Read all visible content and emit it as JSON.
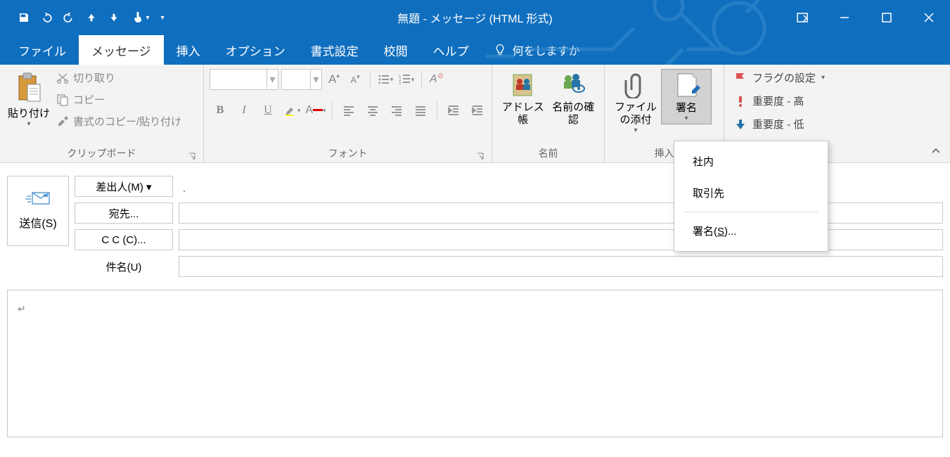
{
  "window": {
    "title": "無題  -  メッセージ (HTML 形式)"
  },
  "tabs": {
    "file": "ファイル",
    "message": "メッセージ",
    "insert": "挿入",
    "options": "オプション",
    "format": "書式設定",
    "review": "校閲",
    "help": "ヘルプ",
    "tell_me": "何をしますか"
  },
  "ribbon": {
    "clipboard": {
      "label": "クリップボード",
      "paste": "貼り付け",
      "cut": "切り取り",
      "copy": "コピー",
      "format_painter": "書式のコピー/貼り付け"
    },
    "font": {
      "label": "フォント",
      "bold": "B",
      "italic": "I",
      "underline": "U",
      "font_color": "A"
    },
    "names": {
      "label": "名前",
      "address_book": "アドレス帳",
      "check_names": "名前の確認"
    },
    "insert": {
      "label": "挿入",
      "attach_file": "ファイルの添付",
      "signature": "署名"
    },
    "tags": {
      "flag": "フラグの設定",
      "high": "重要度 - 高",
      "low": "重要度 - 低"
    }
  },
  "signature_menu": {
    "item1": "社内",
    "item2": "取引先",
    "signatures_link_prefix": "署名(",
    "signatures_link_key": "S",
    "signatures_link_suffix": ")..."
  },
  "compose": {
    "send": "送信(S)",
    "from_btn": "差出人(M) ▾",
    "from_value": "ˎ",
    "to_btn": "宛先...",
    "cc_btn": "C C (C)...",
    "subject_label": "件名(U)",
    "body_marker": "↵"
  }
}
